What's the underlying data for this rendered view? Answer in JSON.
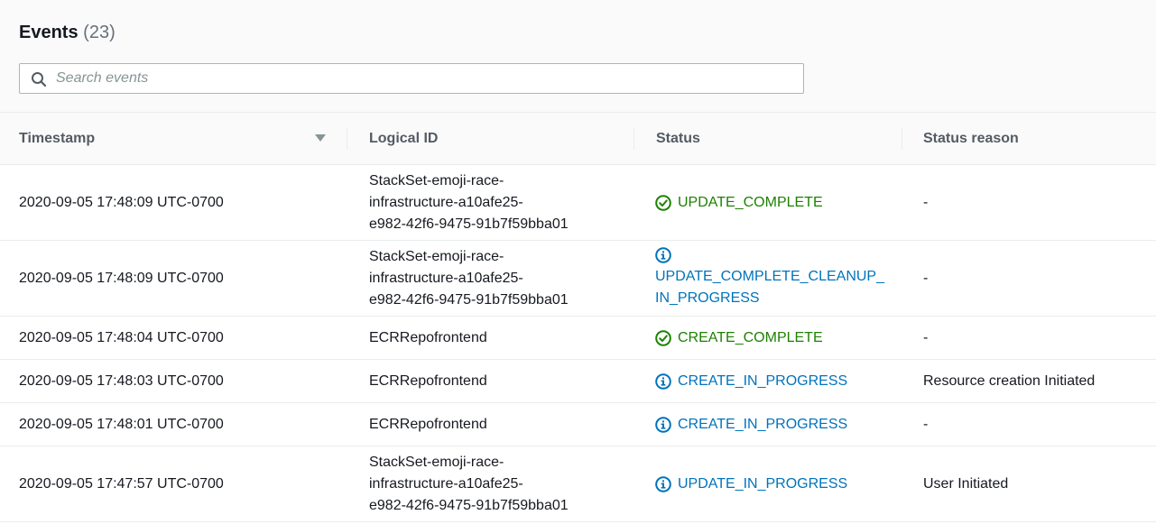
{
  "header": {
    "title": "Events",
    "count": "(23)"
  },
  "search": {
    "placeholder": "Search events",
    "value": ""
  },
  "table": {
    "columns": [
      "Timestamp",
      "Logical ID",
      "Status",
      "Status reason"
    ],
    "sort_icon": "caret-down-icon",
    "rows": [
      {
        "timestamp": "2020-09-05 17:48:09 UTC-0700",
        "logical_id": [
          "StackSet-emoji-race-",
          "infrastructure-a10afe25-",
          "e982-42f6-9475-91b7f59bba01"
        ],
        "status": [
          "UPDATE_COMPLETE"
        ],
        "status_type": "success",
        "status_icon": "check-circle-icon",
        "status_reason": "-"
      },
      {
        "timestamp": "2020-09-05 17:48:09 UTC-0700",
        "logical_id": [
          "StackSet-emoji-race-",
          "infrastructure-a10afe25-",
          "e982-42f6-9475-91b7f59bba01"
        ],
        "status": [
          "UPDATE_COMPLETE_CLEANUP_",
          "IN_PROGRESS"
        ],
        "status_type": "info",
        "status_icon": "info-circle-icon",
        "status_reason": "-"
      },
      {
        "timestamp": "2020-09-05 17:48:04 UTC-0700",
        "logical_id": [
          "ECRRepofrontend"
        ],
        "status": [
          "CREATE_COMPLETE"
        ],
        "status_type": "success",
        "status_icon": "check-circle-icon",
        "status_reason": "-"
      },
      {
        "timestamp": "2020-09-05 17:48:03 UTC-0700",
        "logical_id": [
          "ECRRepofrontend"
        ],
        "status": [
          "CREATE_IN_PROGRESS"
        ],
        "status_type": "info",
        "status_icon": "info-circle-icon",
        "status_reason": "Resource creation Initiated"
      },
      {
        "timestamp": "2020-09-05 17:48:01 UTC-0700",
        "logical_id": [
          "ECRRepofrontend"
        ],
        "status": [
          "CREATE_IN_PROGRESS"
        ],
        "status_type": "info",
        "status_icon": "info-circle-icon",
        "status_reason": "-"
      },
      {
        "timestamp": "2020-09-05 17:47:57 UTC-0700",
        "logical_id": [
          "StackSet-emoji-race-",
          "infrastructure-a10afe25-",
          "e982-42f6-9475-91b7f59bba01"
        ],
        "status": [
          "UPDATE_IN_PROGRESS"
        ],
        "status_type": "info",
        "status_icon": "info-circle-icon",
        "status_reason": "User Initiated"
      }
    ]
  },
  "colors": {
    "success": "#1d8102",
    "info": "#0073bb"
  }
}
